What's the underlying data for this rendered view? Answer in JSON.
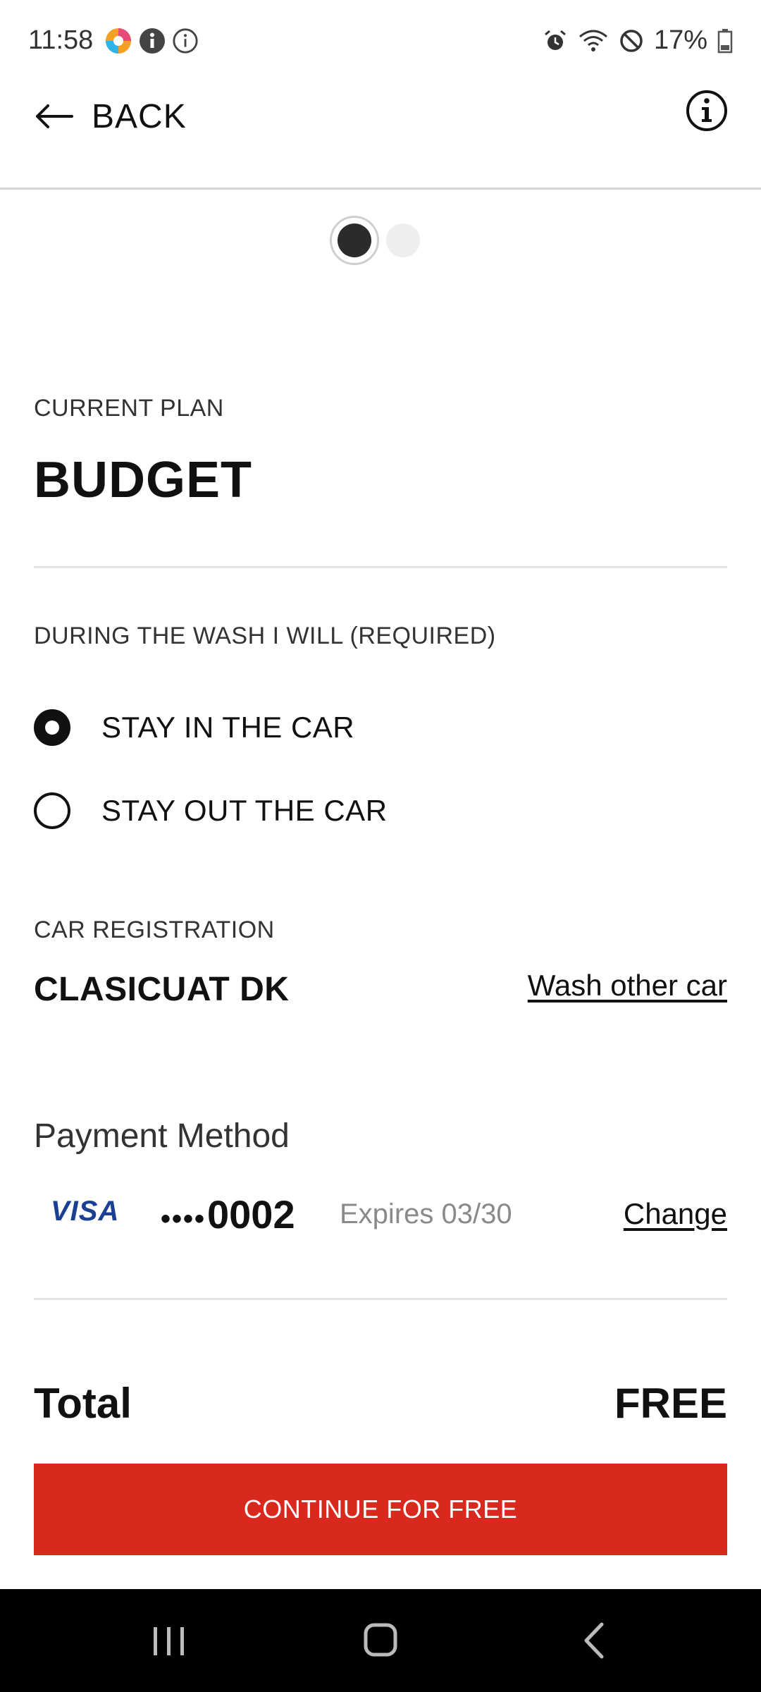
{
  "status_bar": {
    "time": "11:58",
    "battery_percent": "17%",
    "left_icons": [
      "app-notification-icon",
      "info-filled-icon",
      "info-outline-icon"
    ],
    "right_icons": [
      "alarm-icon",
      "wifi-icon",
      "do-not-disturb-icon",
      "battery-icon"
    ]
  },
  "app_bar": {
    "back_label": "BACK",
    "back_icon": "arrow-left-icon",
    "info_icon": "info-circle-icon"
  },
  "pager": {
    "total_pages": 2,
    "current_page": 1
  },
  "plan": {
    "label": "CURRENT PLAN",
    "name": "BUDGET"
  },
  "wash_option": {
    "label": "DURING THE WASH I WILL (REQUIRED)",
    "options": [
      {
        "label": "STAY IN THE CAR",
        "selected": true
      },
      {
        "label": "STAY OUT THE CAR",
        "selected": false
      }
    ]
  },
  "registration": {
    "label": "CAR REGISTRATION",
    "value": "CLASICUAT DK",
    "other_car_link": "Wash other car"
  },
  "payment": {
    "title": "Payment Method",
    "brand": "VISA",
    "masked_dots": "••••",
    "last4": "0002",
    "expiry": "Expires 03/30",
    "change_label": "Change"
  },
  "total": {
    "label": "Total",
    "value": "FREE"
  },
  "cta": {
    "label": "CONTINUE FOR FREE",
    "color": "#d9291e"
  },
  "nav_bar": {
    "buttons": [
      "recent-apps-icon",
      "home-icon",
      "back-chevron-icon"
    ]
  }
}
